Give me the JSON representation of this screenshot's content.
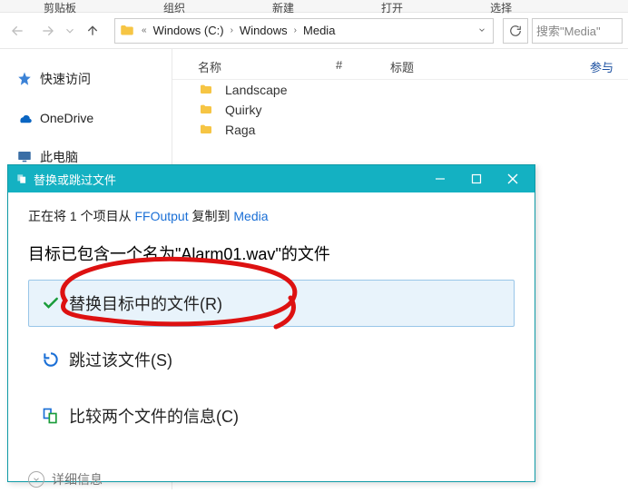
{
  "ribbon": {
    "items": [
      "剪贴板",
      "组织",
      "新建",
      "打开",
      "选择"
    ]
  },
  "nav": {
    "drive_label": "Windows (C:)",
    "segments": [
      "Windows",
      "Media"
    ],
    "search_placeholder": "搜索\"Media\""
  },
  "sidebar": {
    "items": [
      {
        "label": "快速访问",
        "icon": "star"
      },
      {
        "label": "OneDrive",
        "icon": "onedrive"
      },
      {
        "label": "此电脑",
        "icon": "pc"
      }
    ]
  },
  "columns": {
    "name": "名称",
    "hash": "#",
    "title": "标题",
    "participate": "参与"
  },
  "files": [
    "Landscape",
    "Quirky",
    "Raga"
  ],
  "dialog": {
    "title": "替换或跳过文件",
    "progress_prefix": "正在将 1 个项目从",
    "progress_src": "FFOutput",
    "progress_mid": "复制到",
    "progress_dst": "Media",
    "conflict_prefix": "目标已包含一个名为\"",
    "conflict_file": "Alarm01.wav",
    "conflict_suffix": "\"的文件",
    "opt_replace": "替换目标中的文件(R)",
    "opt_skip": "跳过该文件(S)",
    "opt_compare": "比较两个文件的信息(C)",
    "details": "详细信息"
  }
}
